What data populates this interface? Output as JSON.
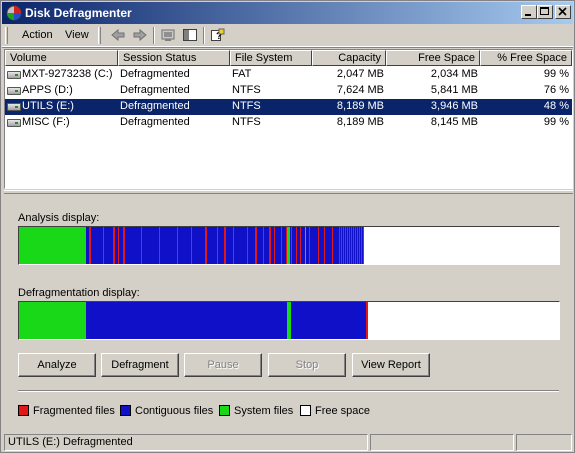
{
  "window": {
    "title": "Disk Defragmenter"
  },
  "menu": {
    "items": [
      "Action",
      "View"
    ]
  },
  "toolbar": {
    "icons": [
      "back-arrow-icon",
      "forward-arrow-icon",
      "computer-icon",
      "show-hide-pane-icon",
      "help-icon"
    ]
  },
  "volumes": {
    "columns": [
      "Volume",
      "Session Status",
      "File System",
      "Capacity",
      "Free Space",
      "% Free Space"
    ],
    "rows": [
      {
        "volume": "MXT-9273238 (C:)",
        "status": "Defragmented",
        "fs": "FAT",
        "capacity": "2,047 MB",
        "free": "2,034 MB",
        "pct": "99 %",
        "selected": false
      },
      {
        "volume": "APPS (D:)",
        "status": "Defragmented",
        "fs": "NTFS",
        "capacity": "7,624 MB",
        "free": "5,841 MB",
        "pct": "76 %",
        "selected": false
      },
      {
        "volume": "UTILS (E:)",
        "status": "Defragmented",
        "fs": "NTFS",
        "capacity": "8,189 MB",
        "free": "3,946 MB",
        "pct": "48 %",
        "selected": true
      },
      {
        "volume": "MISC (F:)",
        "status": "Defragmented",
        "fs": "NTFS",
        "capacity": "8,189 MB",
        "free": "8,145 MB",
        "pct": "99 %",
        "selected": false
      }
    ]
  },
  "analysis": {
    "label": "Analysis display:"
  },
  "defrag": {
    "label": "Defragmentation display:"
  },
  "buttons": {
    "analyze": "Analyze",
    "defragment": "Defragment",
    "pause": "Pause",
    "stop": "Stop",
    "report": "View Report"
  },
  "legend": {
    "fragmented": "Fragmented files",
    "contiguous": "Contiguous files",
    "system": "System files",
    "free": "Free space"
  },
  "colors": {
    "fragmented": "#e01818",
    "contiguous": "#1010c8",
    "system": "#18d818",
    "free": "#ffffff",
    "selection": "#0a246a"
  },
  "status": {
    "text": "UTILS (E:) Defragmented"
  }
}
